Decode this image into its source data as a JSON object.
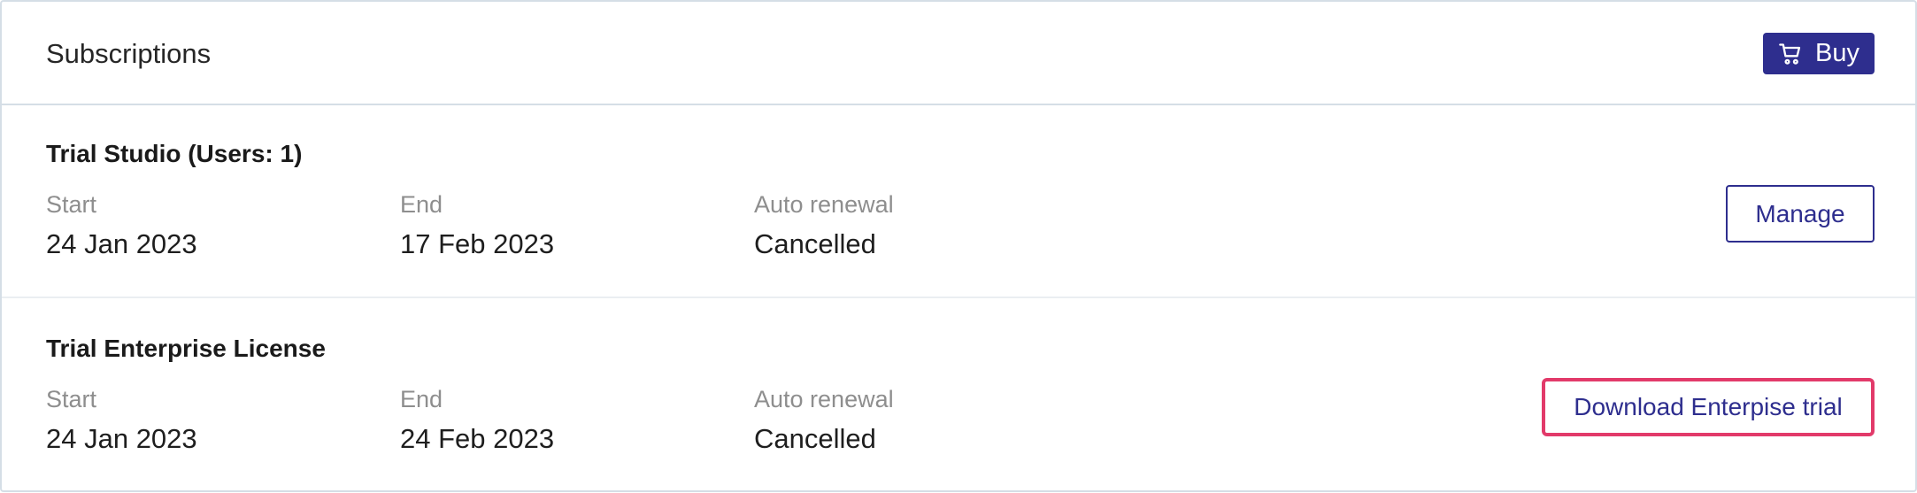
{
  "header": {
    "title": "Subscriptions",
    "buy_label": "Buy",
    "buy_icon": "cart-icon"
  },
  "subscriptions": [
    {
      "title": "Trial Studio (Users: 1)",
      "start_label": "Start",
      "start_value": "24 Jan 2023",
      "end_label": "End",
      "end_value": "17 Feb 2023",
      "renewal_label": "Auto renewal",
      "renewal_value": "Cancelled",
      "action_label": "Manage"
    },
    {
      "title": "Trial Enterprise License",
      "start_label": "Start",
      "start_value": "24 Jan 2023",
      "end_label": "End",
      "end_value": "24 Feb 2023",
      "renewal_label": "Auto renewal",
      "renewal_value": "Cancelled",
      "action_label": "Download Enterpise trial"
    }
  ],
  "colors": {
    "primary": "#2e2e8e",
    "highlight": "#e23a6a",
    "border": "#d5dee6",
    "muted_text": "#8e8e8e"
  }
}
